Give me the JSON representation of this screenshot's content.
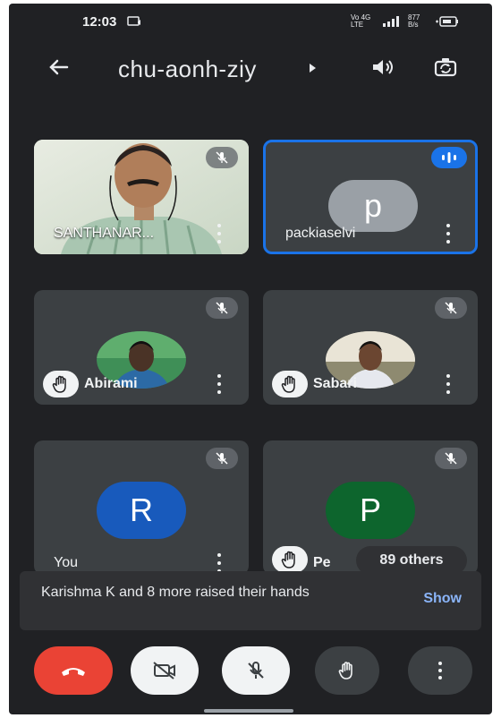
{
  "status": {
    "time": "12:03",
    "network": "Vo 4G LTE",
    "speed": "877 B/s"
  },
  "header": {
    "meeting_code": "chu-aonh-ziy"
  },
  "participants": [
    {
      "name": "SANTHANAR...",
      "muted": true,
      "hand_raised": false,
      "kind": "video"
    },
    {
      "name": "packiaselvi",
      "initial": "p",
      "speaking": true,
      "hand_raised": false,
      "avatar_color": "#9aa0a6"
    },
    {
      "name": "Abirami",
      "muted": true,
      "hand_raised": true,
      "kind": "photo"
    },
    {
      "name": "Sabari",
      "muted": true,
      "hand_raised": true,
      "kind": "photo"
    },
    {
      "name": "You",
      "initial": "R",
      "muted": true,
      "hand_raised": false,
      "avatar_color": "#185abc"
    },
    {
      "name": "Pe",
      "initial": "P",
      "muted": true,
      "hand_raised": true,
      "avatar_color": "#0d652d"
    }
  ],
  "others_chip": "89 others",
  "banner": {
    "text": "Karishma K and 8 more raised their hands",
    "action": "Show"
  },
  "controls": [
    "end-call",
    "camera-off",
    "mic-off",
    "raise-hand",
    "more-options"
  ],
  "colors": {
    "background": "#202124",
    "tile": "#3c4043",
    "end_call": "#ea4335",
    "accent": "#8ab4f8",
    "active_border": "#1a73e8"
  }
}
